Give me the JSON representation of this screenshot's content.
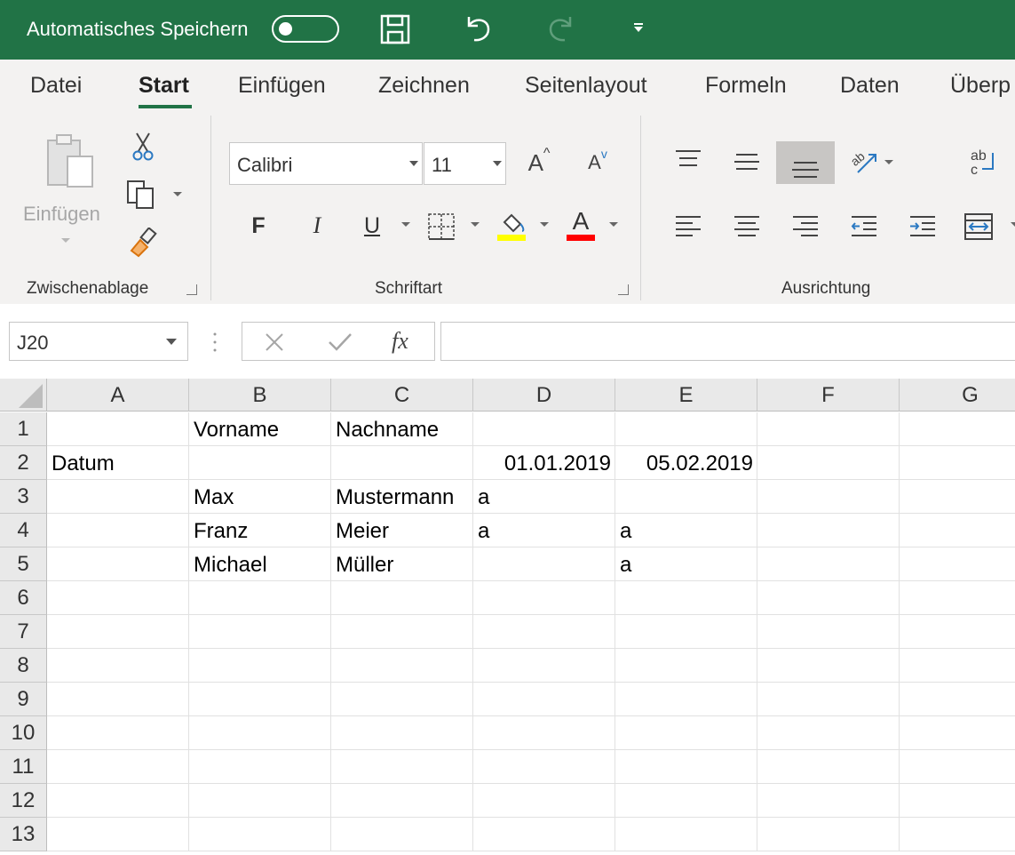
{
  "titlebar": {
    "autosave_label": "Automatisches Speichern",
    "bg_color": "#217346"
  },
  "tabs": [
    "Datei",
    "Start",
    "Einfügen",
    "Zeichnen",
    "Seitenlayout",
    "Formeln",
    "Daten",
    "Überp"
  ],
  "active_tab": "Start",
  "clipboard": {
    "paste_label": "Einfügen",
    "group_label": "Zwischenablage"
  },
  "font": {
    "name": "Calibri",
    "size": "11",
    "bold_label": "F",
    "italic_label": "I",
    "underline_label": "U",
    "grow_label": "A",
    "shrink_label": "A",
    "color_label": "A",
    "highlight_color": "#ffff00",
    "font_color": "#ff0000",
    "group_label": "Schriftart"
  },
  "alignment": {
    "group_label": "Ausrichtung",
    "wrap_label": "ab"
  },
  "formula_bar": {
    "name_box": "J20",
    "fx_label": "fx",
    "formula": ""
  },
  "sheet": {
    "columns": [
      "A",
      "B",
      "C",
      "D",
      "E",
      "F",
      "G"
    ],
    "rows": [
      "1",
      "2",
      "3",
      "4",
      "5",
      "6",
      "7",
      "8",
      "9",
      "10",
      "11",
      "12",
      "13"
    ],
    "cells": [
      [
        "",
        "Vorname",
        "Nachname",
        "",
        "",
        "",
        ""
      ],
      [
        "Datum",
        "",
        "",
        "01.01.2019",
        "05.02.2019",
        "",
        ""
      ],
      [
        "",
        "Max",
        "Mustermann",
        "a",
        "",
        "",
        ""
      ],
      [
        "",
        "Franz",
        "Meier",
        "a",
        "a",
        "",
        ""
      ],
      [
        "",
        "Michael",
        "Müller",
        "",
        "a",
        "",
        ""
      ],
      [
        "",
        "",
        "",
        "",
        "",
        "",
        ""
      ],
      [
        "",
        "",
        "",
        "",
        "",
        "",
        ""
      ],
      [
        "",
        "",
        "",
        "",
        "",
        "",
        ""
      ],
      [
        "",
        "",
        "",
        "",
        "",
        "",
        ""
      ],
      [
        "",
        "",
        "",
        "",
        "",
        "",
        ""
      ],
      [
        "",
        "",
        "",
        "",
        "",
        "",
        ""
      ],
      [
        "",
        "",
        "",
        "",
        "",
        "",
        ""
      ],
      [
        "",
        "",
        "",
        "",
        "",
        "",
        ""
      ]
    ]
  }
}
